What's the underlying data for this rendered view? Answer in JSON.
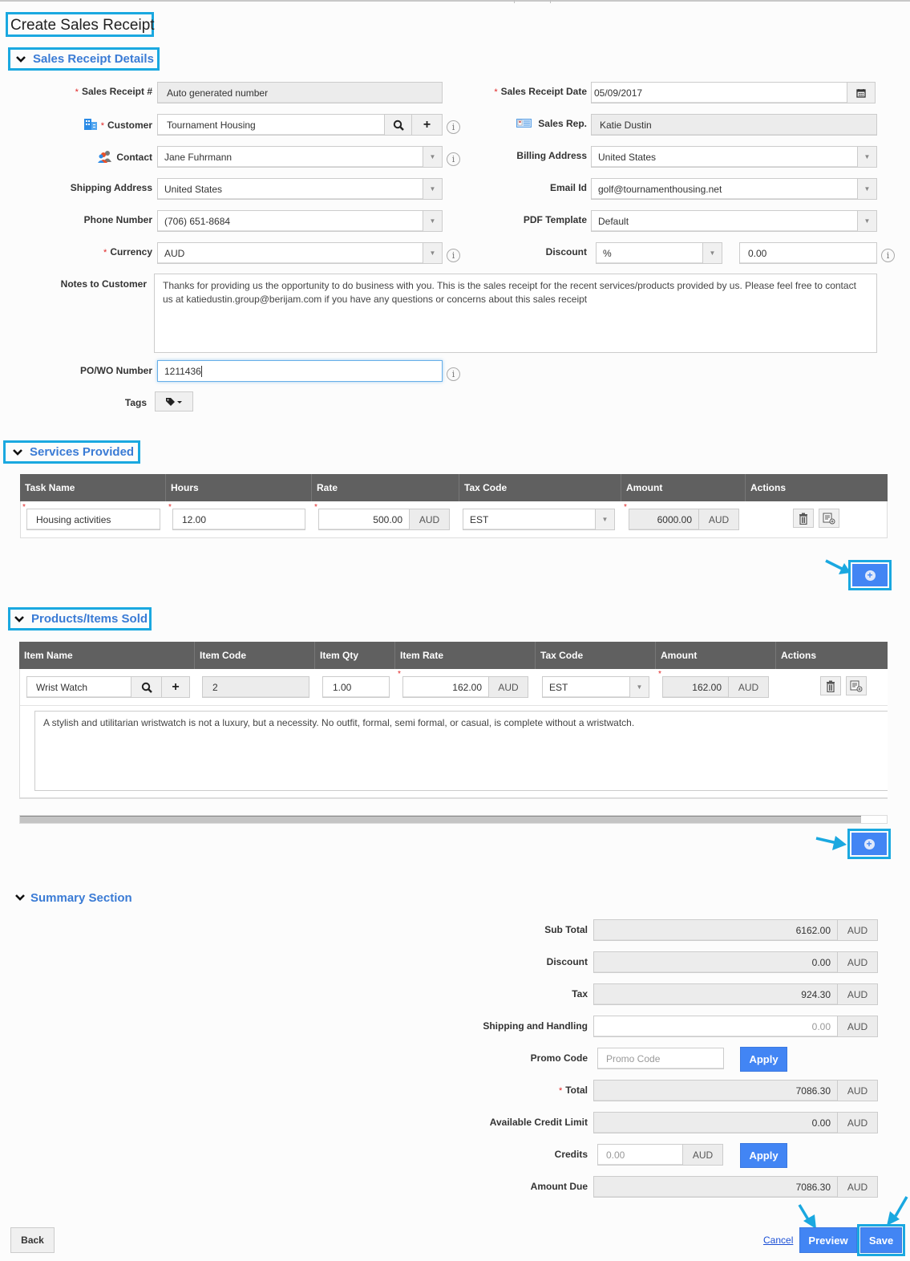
{
  "page": {
    "title": "Create Sales Receipt"
  },
  "sections": {
    "details": "Sales Receipt Details",
    "services": "Services Provided",
    "products": "Products/Items Sold",
    "summary": "Summary Section"
  },
  "details": {
    "sales_receipt_no": {
      "label": "Sales Receipt #",
      "value": "Auto generated number"
    },
    "customer": {
      "label": "Customer",
      "value": "Tournament Housing"
    },
    "contact": {
      "label": "Contact",
      "value": "Jane Fuhrmann"
    },
    "shipping_address": {
      "label": "Shipping Address",
      "value": "United States"
    },
    "phone_number": {
      "label": "Phone Number",
      "value": "(706) 651-8684"
    },
    "currency": {
      "label": "Currency",
      "value": "AUD"
    },
    "notes": {
      "label": "Notes to Customer",
      "value": "Thanks for providing us the opportunity to do business with you. This is the sales receipt for the recent services/products provided by us. Please feel free to contact us at katiedustin.group@berijam.com if you have any questions or concerns about this sales receipt"
    },
    "po_wo_number": {
      "label": "PO/WO Number",
      "value": "1211436"
    },
    "tags": {
      "label": "Tags"
    },
    "sales_receipt_date": {
      "label": "Sales Receipt Date",
      "value": "05/09/2017"
    },
    "sales_rep": {
      "label": "Sales Rep.",
      "value": "Katie Dustin"
    },
    "billing_address": {
      "label": "Billing Address",
      "value": "United States"
    },
    "email_id": {
      "label": "Email Id",
      "value": "golf@tournamenthousing.net"
    },
    "pdf_template": {
      "label": "PDF Template",
      "value": "Default"
    },
    "discount": {
      "label": "Discount",
      "type": "%",
      "value": "0.00"
    }
  },
  "services": {
    "columns": [
      "Task Name",
      "Hours",
      "Rate",
      "Tax Code",
      "Amount",
      "Actions"
    ],
    "rows": [
      {
        "task_name": "Housing activities",
        "hours": "12.00",
        "rate": "500.00",
        "rate_currency": "AUD",
        "tax_code": "EST",
        "amount": "6000.00",
        "amount_currency": "AUD"
      }
    ]
  },
  "products": {
    "columns": [
      "Item Name",
      "Item Code",
      "Item Qty",
      "Item Rate",
      "Tax Code",
      "Amount",
      "Actions"
    ],
    "rows": [
      {
        "item_name": "Wrist Watch",
        "item_code": "2",
        "item_qty": "1.00",
        "item_rate": "162.00",
        "rate_currency": "AUD",
        "tax_code": "EST",
        "amount": "162.00",
        "amount_currency": "AUD",
        "description": "A stylish and utilitarian wristwatch is not a luxury, but a necessity. No outfit, formal, semi formal, or casual, is complete without a wristwatch."
      }
    ],
    "scroll_fraction": 0.97
  },
  "summary": {
    "currency": "AUD",
    "sub_total": {
      "label": "Sub Total",
      "value": "6162.00"
    },
    "discount": {
      "label": "Discount",
      "value": "0.00"
    },
    "tax": {
      "label": "Tax",
      "value": "924.30"
    },
    "shipping": {
      "label": "Shipping and Handling",
      "placeholder": "0.00"
    },
    "promo_code": {
      "label": "Promo Code",
      "placeholder": "Promo Code",
      "apply": "Apply"
    },
    "total": {
      "label": "Total",
      "value": "7086.30"
    },
    "credit_limit": {
      "label": "Available Credit Limit",
      "value": "0.00"
    },
    "credits": {
      "label": "Credits",
      "placeholder": "0.00",
      "apply": "Apply"
    },
    "amount_due": {
      "label": "Amount Due",
      "value": "7086.30"
    }
  },
  "footer": {
    "back": "Back",
    "cancel": "Cancel",
    "preview": "Preview",
    "save": "Save"
  },
  "colors": {
    "accent": "#4285f4",
    "highlight": "#1aa8e0",
    "header": "#606060",
    "required": "#e02424"
  }
}
